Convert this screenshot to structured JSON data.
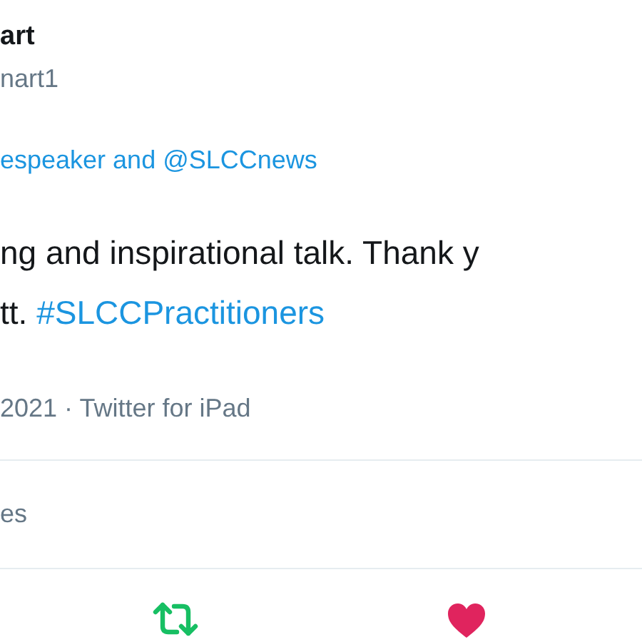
{
  "author": {
    "name": "art",
    "handle": "nart1"
  },
  "replying_to": "espeaker and @SLCCnews",
  "tweet": {
    "lines": [
      "ng and inspirational talk. Thank y",
      "tt. **#SLCCPractitioners**"
    ]
  },
  "meta": "2021 · Twitter for iPad",
  "stats": "es",
  "actions": {
    "retweeted": true,
    "liked": true
  }
}
